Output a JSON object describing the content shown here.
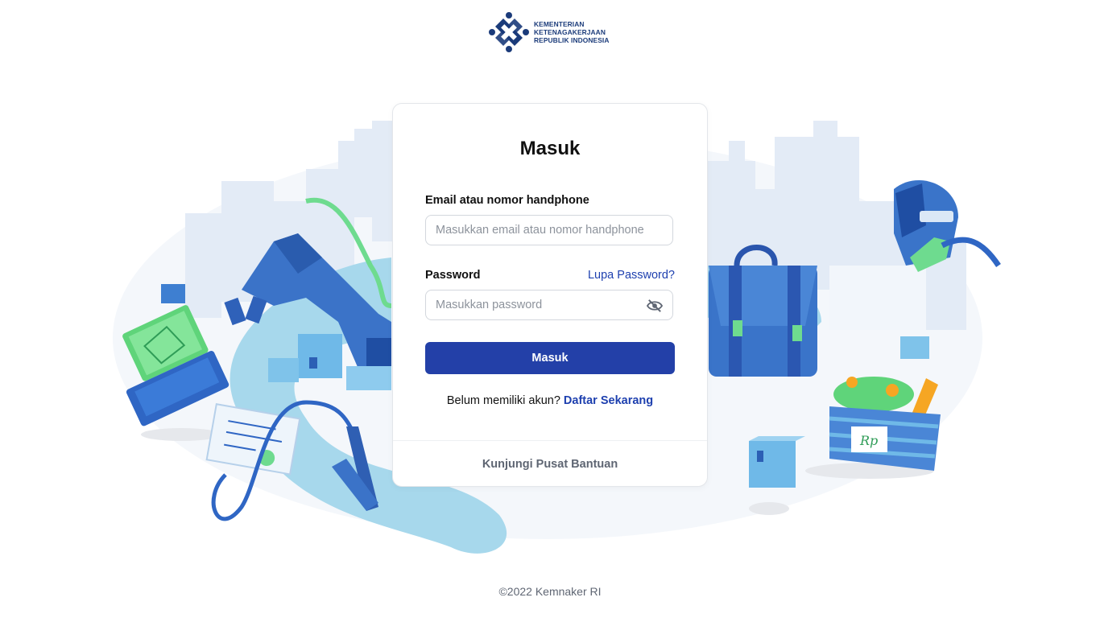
{
  "logo": {
    "line1": "KEMENTERIAN",
    "line2": "KETENAGAKERJAAN",
    "line3": "REPUBLIK INDONESIA",
    "color": "#1b3b7a"
  },
  "login": {
    "title": "Masuk",
    "email_label": "Email atau nomor handphone",
    "email_value": "",
    "email_placeholder": "Masukkan email atau nomor handphone",
    "password_label": "Password",
    "forgot_label": "Lupa Password?",
    "password_value": "",
    "password_placeholder": "Masukkan password",
    "toggle_icon": "eye-off-icon",
    "submit_label": "Masuk",
    "signup_prompt": "Belum memiliki akun?",
    "signup_link": "Daftar Sekarang",
    "help_link": "Kunjungi Pusat Bantuan"
  },
  "illustration": {
    "price_tag": "Rp",
    "accent_color": "#2340a8"
  },
  "footer": {
    "copyright": "©2022 Kemnaker RI"
  }
}
